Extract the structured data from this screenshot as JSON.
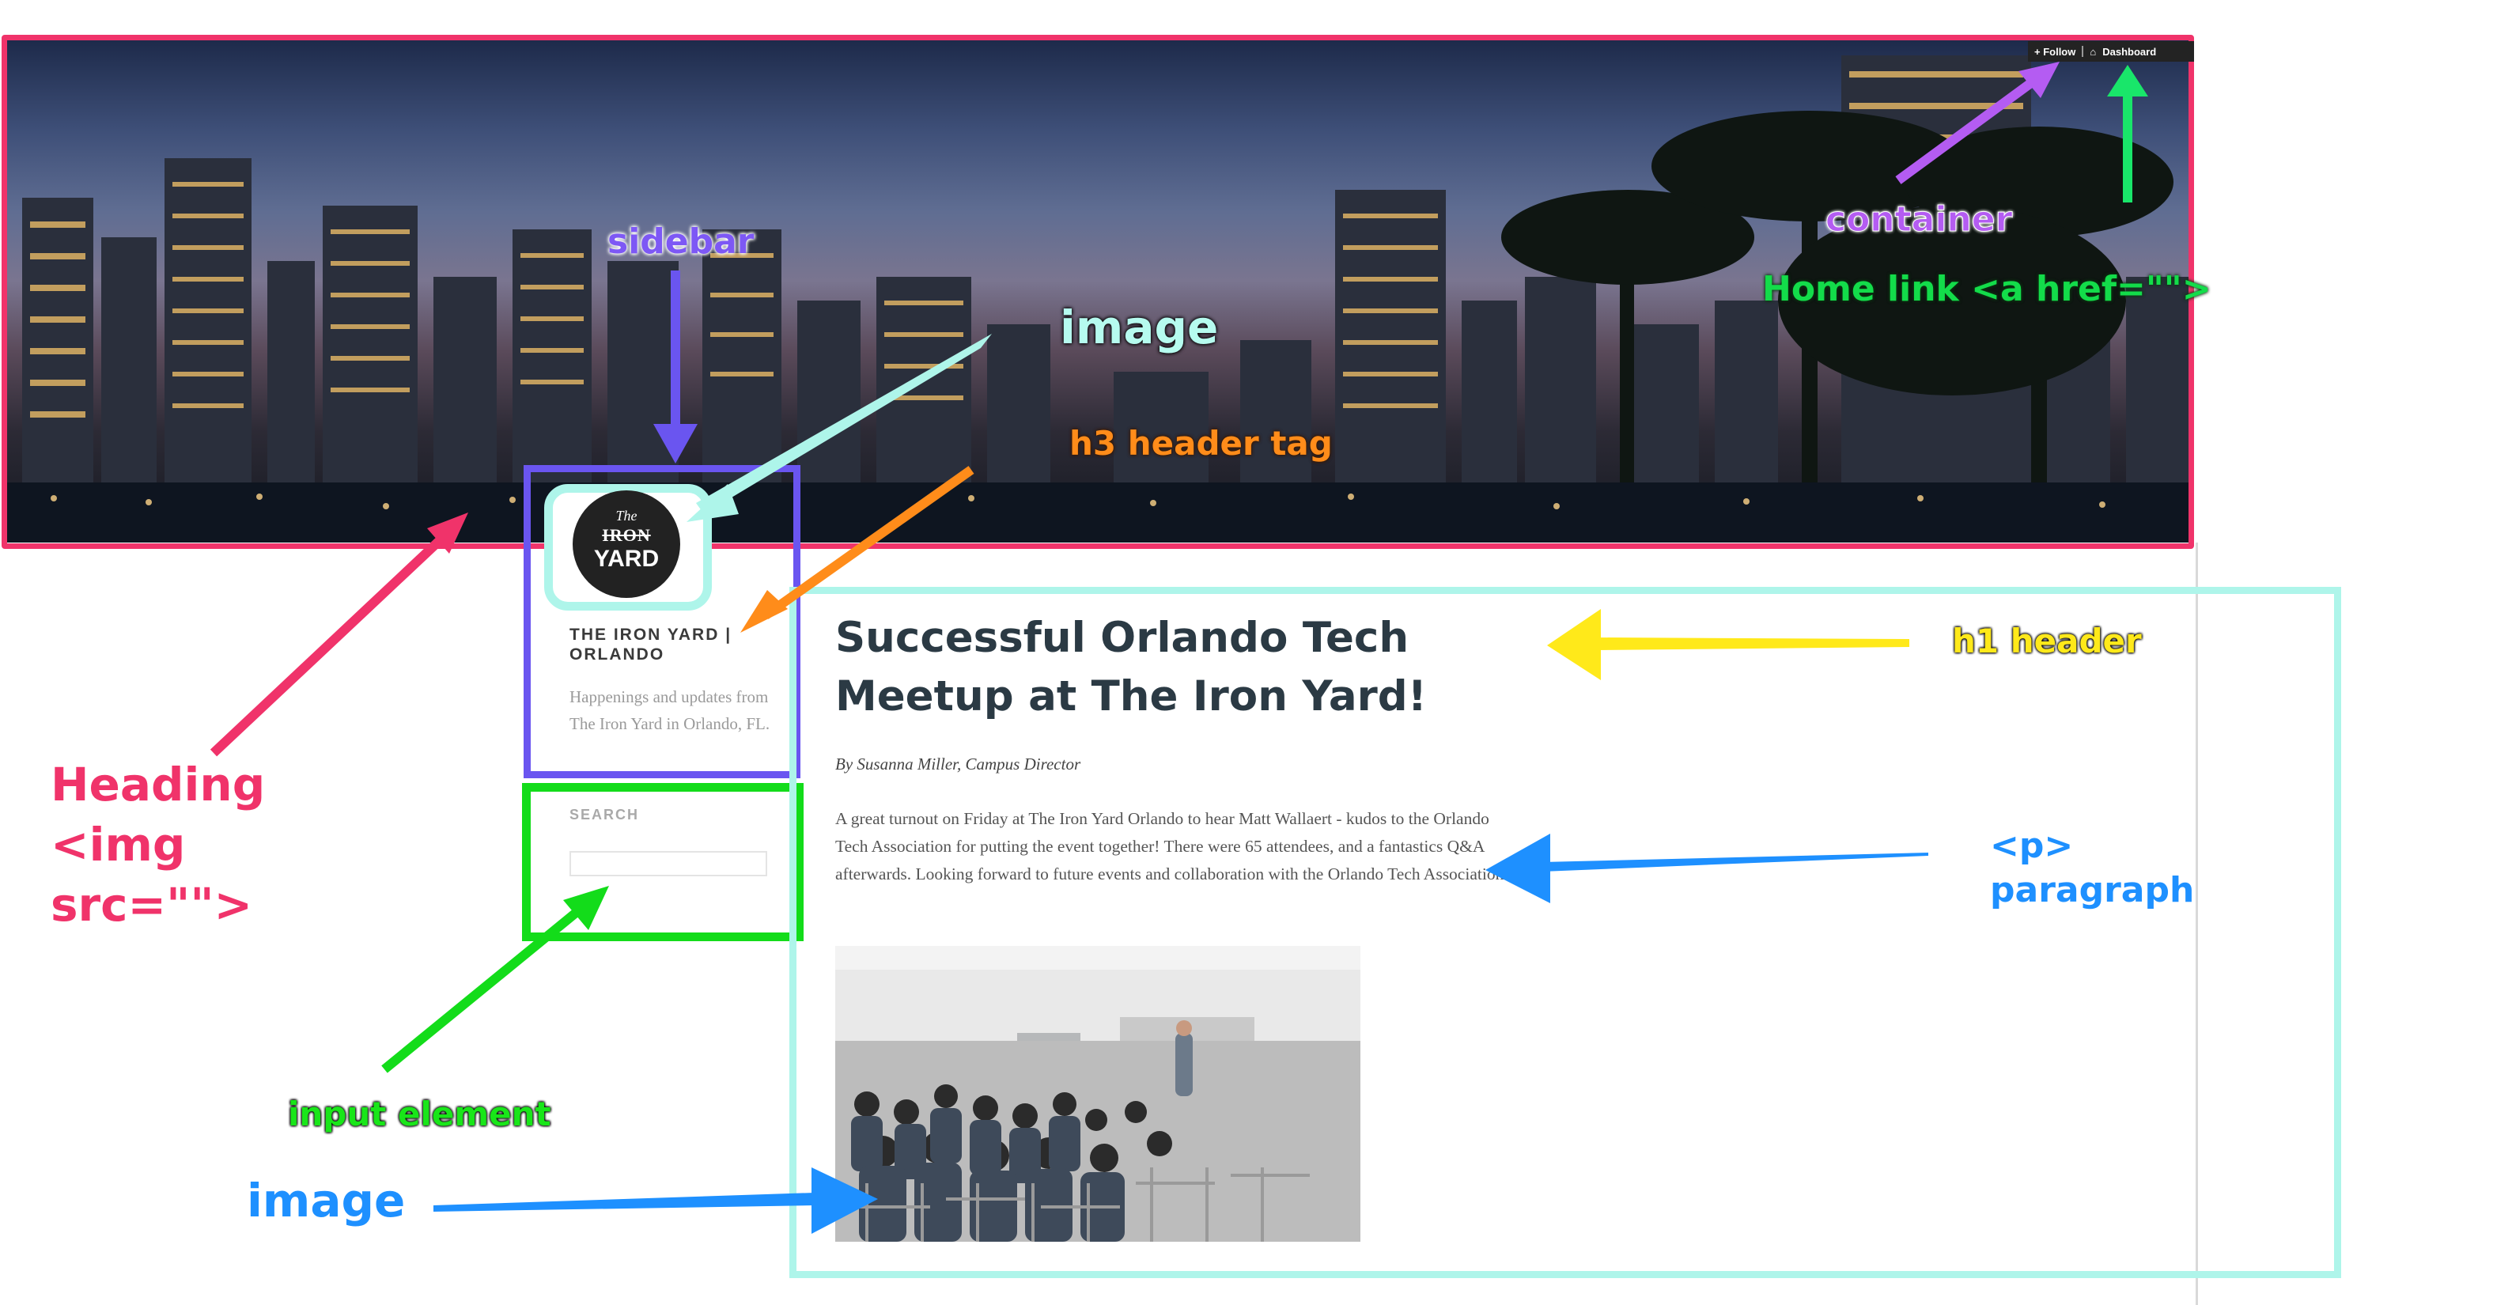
{
  "admin_bar": {
    "follow_label": "+ Follow",
    "dashboard_label": "Dashboard"
  },
  "sidebar": {
    "logo": {
      "line1": "The",
      "line2": "IRON",
      "line3": "YARD"
    },
    "site_title": "THE IRON YARD | ORLANDO",
    "site_description": "Happenings and updates from The Iron Yard in Orlando, FL.",
    "search_label": "SEARCH",
    "search_value": ""
  },
  "post": {
    "title": "Successful Orlando Tech Meetup at The Iron Yard!",
    "byline": "By Susanna Miller, Campus Director",
    "body": "A great turnout on Friday at The Iron Yard Orlando to hear Matt Wallaert - kudos to the Orlando Tech Association for putting the event together! There were 65 attendees, and a fantastics Q&A afterwards. Looking forward to future events and collaboration with the Orlando Tech Association!"
  },
  "annotations": {
    "container": "container",
    "home_link": "Home link <a href=\"\">",
    "sidebar": "sidebar",
    "image_top": "image",
    "h3_tag": "h3 header tag",
    "h1_header": "h1 header",
    "heading_img": "Heading <img src=\"\">",
    "p_tag": "<p>",
    "paragraph": "paragraph",
    "input_element": "input element",
    "image_bottom": "image"
  },
  "colors": {
    "container_border": "#f0336a",
    "sidebar_border": "#6a55f0",
    "search_border": "#13dc1a",
    "image_border": "#aef5ea",
    "h3_arrow": "#ff8c1a",
    "h1_arrow": "#ffe91a",
    "paragraph_arrow": "#1e90ff"
  }
}
